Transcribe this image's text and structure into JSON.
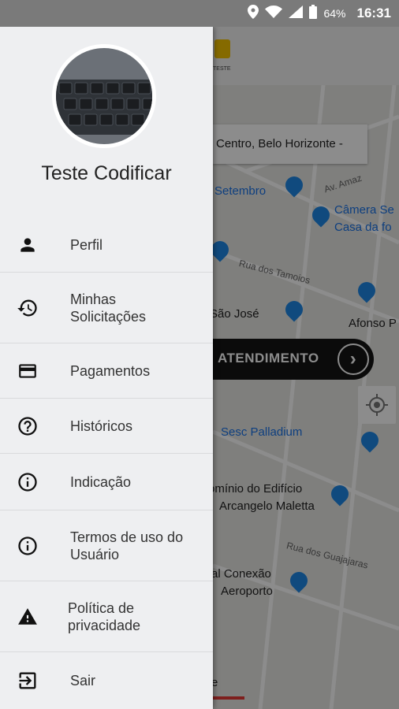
{
  "status_bar": {
    "battery": "64%",
    "time": "16:31"
  },
  "map": {
    "address": "Centro, Belo Horizonte -",
    "logo_text": "TESTE",
    "places": [
      "Setembro",
      "Câmera Se",
      "Casa da fo",
      "São José",
      "Afonso P",
      "Sesc Palladium",
      "omínio do Edifício",
      "Arcangelo Maletta",
      "al Conexão",
      "Aeroporto"
    ],
    "streets": [
      "Av. Amaz",
      "Rua dos Tamoios",
      "Rua dos Guajajaras"
    ],
    "attend_label": "ATENDIMENTO",
    "bottom_letter": "e"
  },
  "drawer": {
    "user_name": "Teste Codificar",
    "menu": [
      {
        "label": "Perfil",
        "icon": "person-icon"
      },
      {
        "label": "Minhas\nSolicitações",
        "icon": "history-icon"
      },
      {
        "label": "Pagamentos",
        "icon": "credit-card-icon"
      },
      {
        "label": "Históricos",
        "icon": "help-circle-icon"
      },
      {
        "label": "Indicação",
        "icon": "info-icon"
      },
      {
        "label": "Termos de uso do\nUsuário",
        "icon": "info-icon"
      },
      {
        "label": "Política de\nprivacidade",
        "icon": "warning-icon"
      },
      {
        "label": "Sair",
        "icon": "exit-icon"
      }
    ]
  },
  "colors": {
    "drawer_bg": "#eeeff1",
    "attend_bg": "#141414",
    "accent_red": "#e53935",
    "map_blue": "#1e88e5"
  }
}
